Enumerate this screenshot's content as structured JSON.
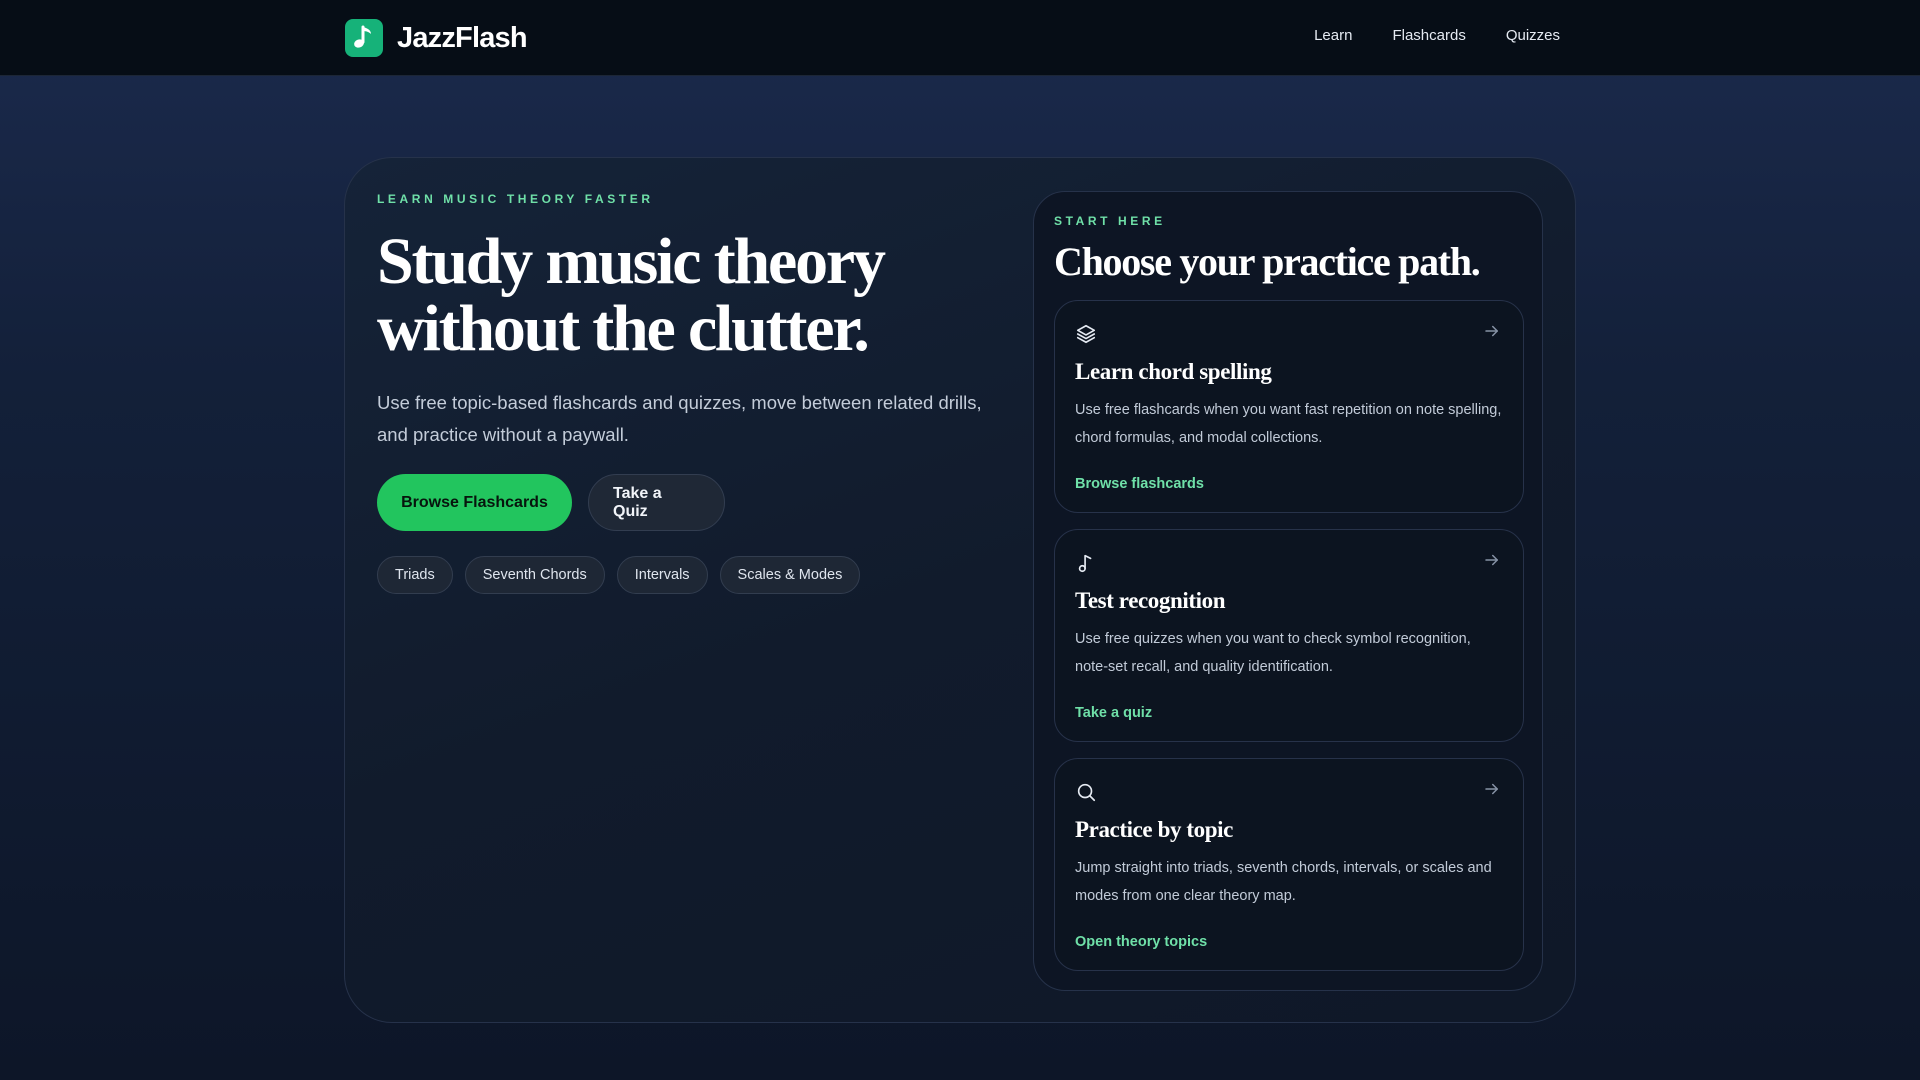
{
  "brand": {
    "name": "JazzFlash",
    "logo_icon": "music-note-icon",
    "logo_color": "#16b279"
  },
  "nav": {
    "items": [
      "Learn",
      "Flashcards",
      "Quizzes"
    ]
  },
  "hero": {
    "eyebrow": "LEARN MUSIC THEORY FASTER",
    "headline_line1": "Study music theory",
    "headline_line2": "without the clutter.",
    "lead": "Use free topic-based flashcards and quizzes, move between related drills, and practice without a paywall.",
    "primary_cta": "Browse Flashcards",
    "secondary_cta": "Take a Quiz",
    "chips": [
      "Triads",
      "Seventh Chords",
      "Intervals",
      "Scales & Modes"
    ]
  },
  "panel": {
    "eyebrow": "START HERE",
    "title": "Choose your practice path.",
    "cards": [
      {
        "icon": "layers-icon",
        "title": "Learn chord spelling",
        "description": "Use free flashcards when you want fast repetition on note spelling, chord formulas, and modal collections.",
        "link": "Browse flashcards"
      },
      {
        "icon": "music-note-icon",
        "title": "Test recognition",
        "description": "Use free quizzes when you want to check symbol recognition, note-set recall, and quality identification.",
        "link": "Take a quiz"
      },
      {
        "icon": "search-icon",
        "title": "Practice by topic",
        "description": "Jump straight into triads, seventh chords, intervals, or scales and modes from one clear theory map.",
        "link": "Open theory topics"
      }
    ]
  },
  "colors": {
    "accent": "#22c55e",
    "accent_text": "#6fe0a8",
    "background": "#132039"
  }
}
